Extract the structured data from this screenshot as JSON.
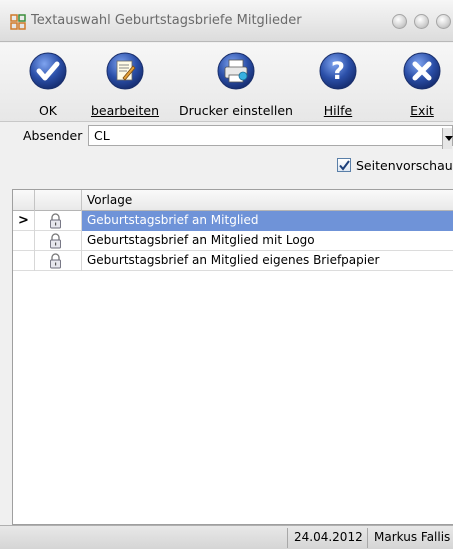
{
  "window": {
    "title": "Textauswahl Geburtstagsbriefe Mitglieder",
    "app_icon": "grid-app-icon"
  },
  "toolbar": {
    "ok_label": "OK",
    "edit_label": "bearbeiten",
    "printer_label": "Drucker einstellen",
    "help_label": "Hilfe",
    "exit_label": "Exit",
    "ok_icon": "checkmark-icon",
    "edit_icon": "edit-document-icon",
    "printer_icon": "printer-icon",
    "help_icon": "question-mark-icon",
    "exit_icon": "close-icon",
    "icon_color": "#2b4fa8"
  },
  "sender": {
    "label": "Absender",
    "value": "CL"
  },
  "preview": {
    "label": "Seitenvorschau",
    "checked": true
  },
  "grid": {
    "column_header": "Vorlage",
    "rows": [
      {
        "text": "Geburtstagsbrief an Mitglied",
        "selected": true,
        "pointer": ">",
        "icon": "lock-icon"
      },
      {
        "text": "Geburtstagsbrief an Mitglied mit Logo",
        "selected": false,
        "pointer": "",
        "icon": "lock-icon"
      },
      {
        "text": "Geburtstagsbrief an Mitglied eigenes Briefpapier",
        "selected": false,
        "pointer": "",
        "icon": "lock-icon"
      }
    ],
    "selection_color": "#6f93d8"
  },
  "statusbar": {
    "date": "24.04.2012",
    "user": "Markus Fallis"
  }
}
